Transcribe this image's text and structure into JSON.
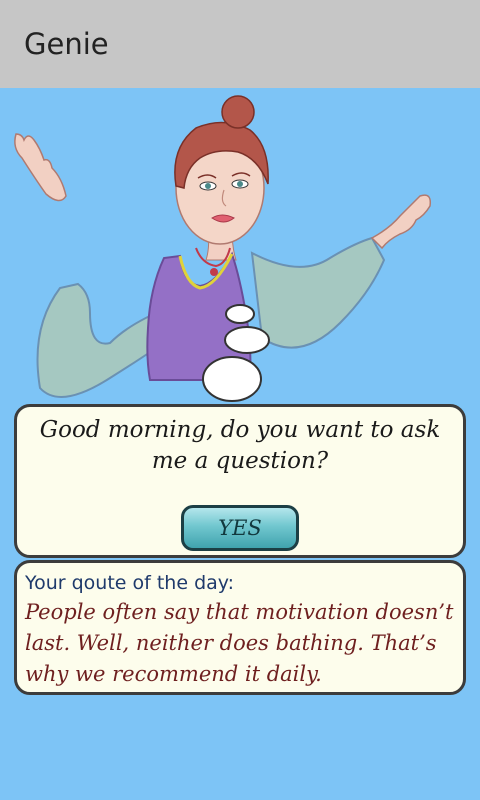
{
  "app": {
    "title": "Genie"
  },
  "question": {
    "text": "Good morning, do you want to ask me a question?",
    "yes_label": "YES"
  },
  "quote": {
    "label": "Your qoute of the day:",
    "text": "People often say that motivation doesn’t last. Well, neither does bathing. That’s why we recommend it daily."
  },
  "colors": {
    "background": "#7dc4f6",
    "titlebar": "#c6c6c6",
    "panel": "#fdfdec",
    "button": "#5fbac4",
    "quote_text": "#6e1f1f",
    "quote_label": "#1f3a6b"
  },
  "icons": {
    "illustration": "genie-illustration",
    "thought_bubble": "thought-bubble-icon"
  }
}
